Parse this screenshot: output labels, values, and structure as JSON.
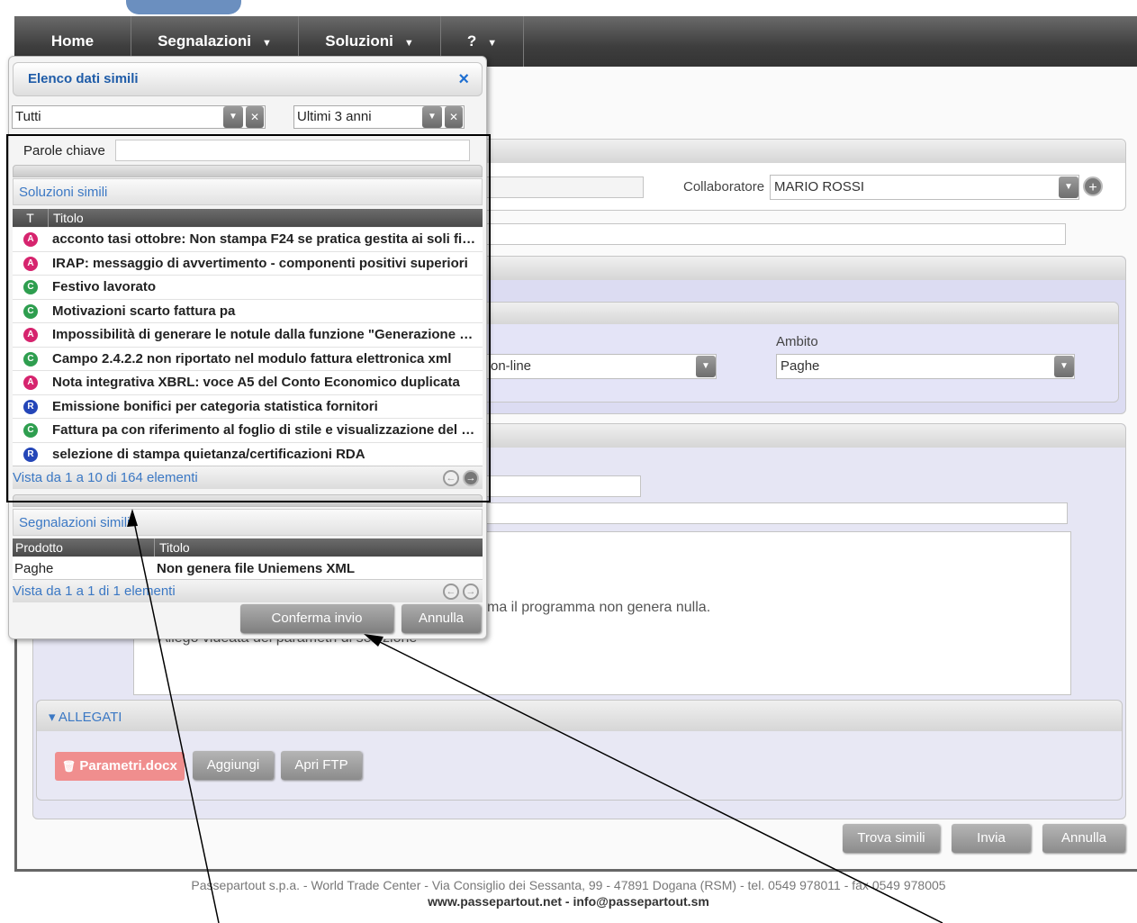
{
  "navbar": {
    "items": [
      {
        "label": "Home",
        "caret": ""
      },
      {
        "label": "Segnalazioni",
        "caret": "▼"
      },
      {
        "label": "Soluzioni",
        "caret": "▼"
      },
      {
        "label": "?",
        "caret": "▼"
      }
    ]
  },
  "form": {
    "collaboratore_label": "Collaboratore",
    "collaboratore_value": "MARIO ROSSI",
    "modalita_value": "on-line",
    "ambito_label": "Ambito",
    "ambito_value": "Paghe",
    "description_line1": "ma il programma non genera nulla.",
    "description_line2": "Allego videata dei parametri di selezione",
    "allegati_label": "ALLEGATI",
    "attachment_file": "Parametri.docx",
    "add_button": "Aggiungi",
    "ftp_button": "Apri FTP",
    "find_similar_button": "Trova simili",
    "send_button": "Invia",
    "cancel_button": "Annulla"
  },
  "footer": {
    "line1": "Passepartout s.p.a. - World Trade Center - Via Consiglio dei Sessanta, 99 - 47891 Dogana (RSM) - tel. 0549 978011 - fax 0549 978005",
    "website": "www.passepartout.net",
    "separator": " - ",
    "email": "info@passepartout.sm"
  },
  "dialog": {
    "title": "Elenco dati simili",
    "close_icon": "×",
    "filter_type": "Tutti",
    "filter_period": "Ultimi 3 anni",
    "keywords_label": "Parole chiave",
    "keywords_value": "",
    "solutions": {
      "section_title": "Soluzioni simili",
      "col_type": "T",
      "col_title": "Titolo",
      "rows": [
        {
          "type": "A",
          "color": "#d6246e",
          "title": "acconto tasi ottobre: Non stampa F24 se pratica gestita ai soli fini IMU"
        },
        {
          "type": "A",
          "color": "#d6246e",
          "title": "IRAP: messaggio di avvertimento - componenti positivi superiori"
        },
        {
          "type": "C",
          "color": "#2e9e4f",
          "title": "Festivo lavorato"
        },
        {
          "type": "C",
          "color": "#2e9e4f",
          "title": "Motivazioni scarto fattura pa"
        },
        {
          "type": "A",
          "color": "#d6246e",
          "title": "Impossibilità di generare le notule dalla funzione \"Generazione notule\""
        },
        {
          "type": "C",
          "color": "#2e9e4f",
          "title": "Campo 2.4.2.2 non riportato nel modulo fattura elettronica xml"
        },
        {
          "type": "A",
          "color": "#d6246e",
          "title": "Nota integrativa XBRL: voce A5 del Conto Economico duplicata"
        },
        {
          "type": "R",
          "color": "#2446b8",
          "title": "Emissione bonifici per categoria statistica fornitori"
        },
        {
          "type": "C",
          "color": "#2e9e4f",
          "title": "Fattura pa con riferimento al foglio di stile e visualizzazione del documento"
        },
        {
          "type": "R",
          "color": "#2446b8",
          "title": "selezione di stampa quietanza/certificazioni RDA"
        }
      ],
      "pager_text": "Vista da 1 a 10 di 164 elementi"
    },
    "reports": {
      "section_title": "Segnalazioni simili",
      "col_product": "Prodotto",
      "col_title": "Titolo",
      "rows": [
        {
          "product": "Paghe",
          "title": "Non genera file Uniemens XML"
        }
      ],
      "pager_text": "Vista da 1 a 1 di 1 elementi"
    },
    "confirm_button": "Conferma invio",
    "cancel_button": "Annulla"
  }
}
